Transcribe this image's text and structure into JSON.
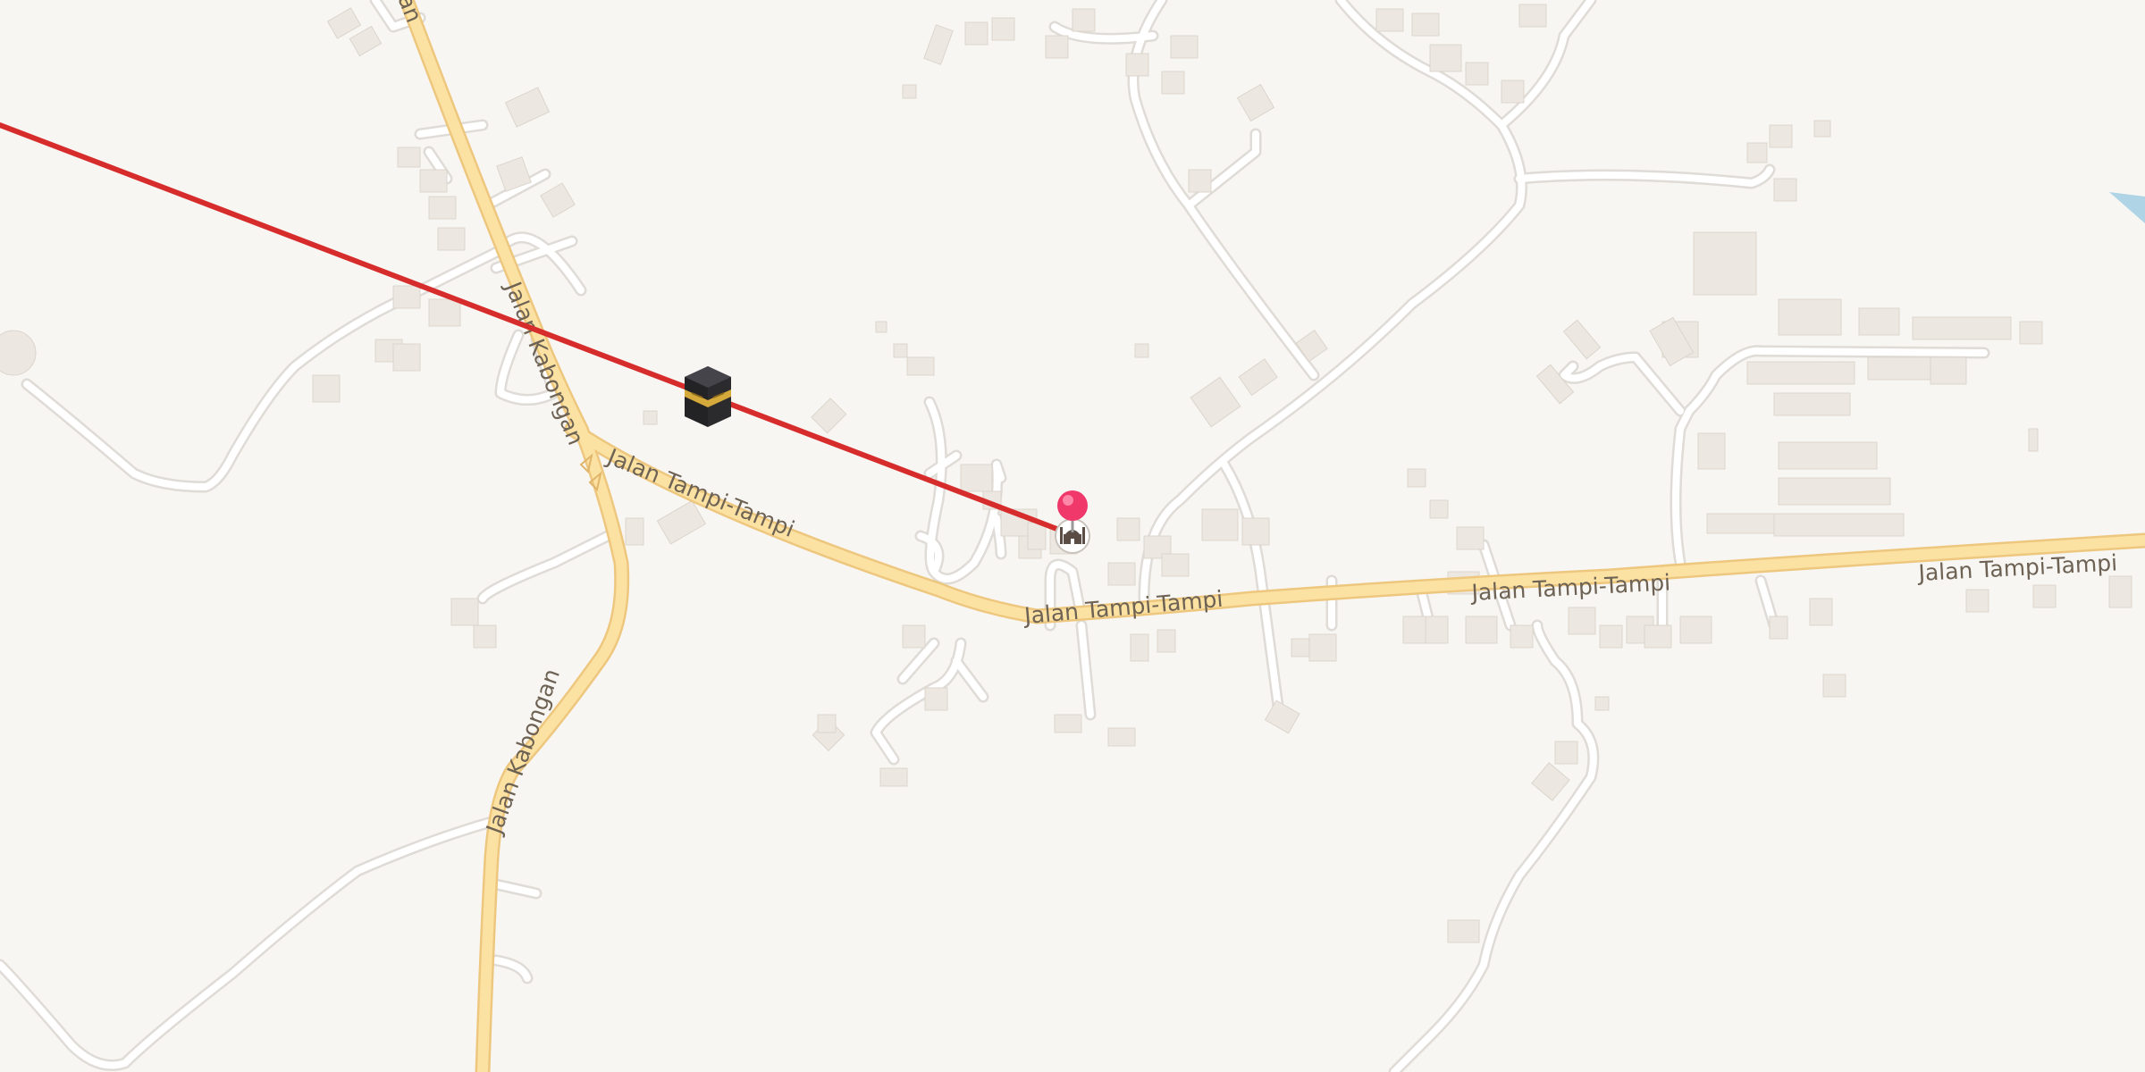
{
  "map": {
    "background_color": "#f8f6f3",
    "road_major_color": "#fbe2a3",
    "road_major_casing_color": "#eec77f",
    "road_minor_color": "#ffffff",
    "road_minor_casing_color": "#dfdbd6",
    "building_color": "#ece7e1",
    "water_color": "#aed4e6",
    "qibla_line_color": "#d72c2c"
  },
  "road_labels": [
    {
      "text": "Jalan Kabongan"
    },
    {
      "text": "Jalan Kabongan"
    },
    {
      "text": "Jalan Tampi-Tampi"
    },
    {
      "text": "Jalan Tampi-Tampi"
    },
    {
      "text": "Jalan Tampi-Tampi"
    },
    {
      "text": "Jalan Tampi-Tampi"
    },
    {
      "text": "an"
    }
  ],
  "markers": {
    "kaaba": {
      "icon": "kaaba-icon"
    },
    "location_pin": {
      "icon": "location-pin-icon",
      "color": "#f0386b"
    },
    "mosque": {
      "icon": "mosque-icon"
    }
  }
}
